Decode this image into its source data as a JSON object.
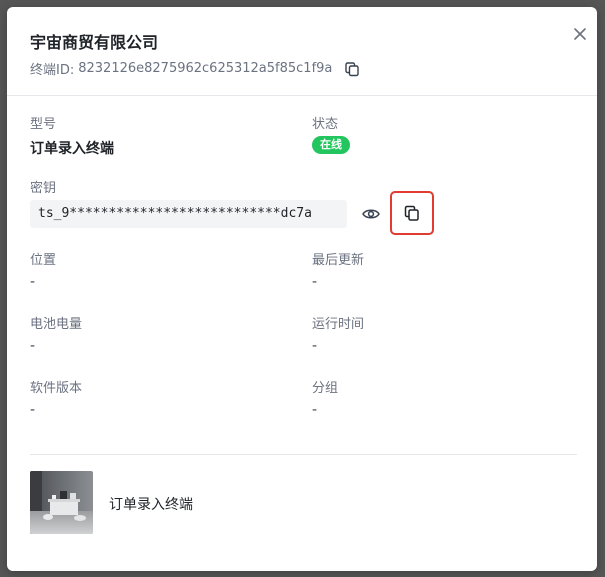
{
  "dialog": {
    "title": "宇宙商贸有限公司",
    "terminal_id_label": "终端ID:",
    "terminal_id": "8232126e8275962c625312a5f85c1f9a"
  },
  "fields": {
    "model_label": "型号",
    "model_value": "订单录入终端",
    "status_label": "状态",
    "status_value": "在线",
    "status_color": "#22c55e",
    "secret_label": "密钥",
    "secret_value": "ts_9***************************dc7a",
    "location_label": "位置",
    "location_value": "-",
    "last_update_label": "最后更新",
    "last_update_value": "-",
    "battery_label": "电池电量",
    "battery_value": "-",
    "uptime_label": "运行时间",
    "uptime_value": "-",
    "software_label": "软件版本",
    "software_value": "-",
    "group_label": "分组",
    "group_value": "-"
  },
  "footer": {
    "device_name": "订单录入终端"
  },
  "icons": {
    "close": "close-icon",
    "copy": "copy-icon",
    "eye": "eye-icon"
  },
  "colors": {
    "highlight_border": "#e03c31"
  }
}
